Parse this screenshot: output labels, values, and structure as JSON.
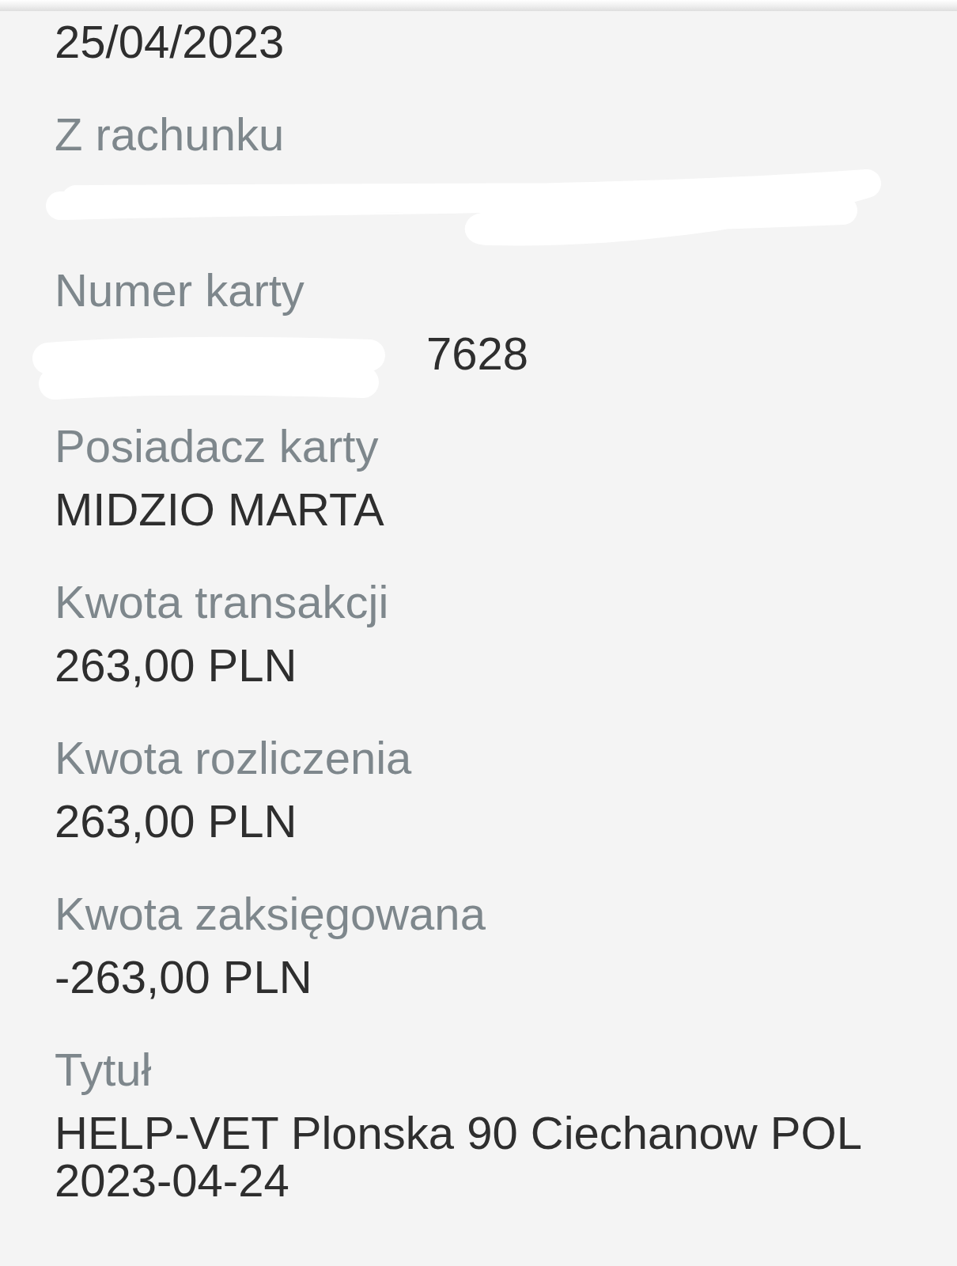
{
  "fields": [
    {
      "value": "25/04/2023",
      "redacted": false
    },
    {
      "label": "Z rachunku",
      "redacted": true
    },
    {
      "label": "Numer karty",
      "redacted": true,
      "value": "7628"
    },
    {
      "label": "Posiadacz karty",
      "value": "MIDZIO MARTA",
      "redacted": false
    },
    {
      "label": "Kwota transakcji",
      "value": "263,00 PLN",
      "redacted": false
    },
    {
      "label": "Kwota rozliczenia",
      "value": "263,00 PLN",
      "redacted": false
    },
    {
      "label": "Kwota zaksięgowana",
      "value": "-263,00 PLN",
      "redacted": false
    },
    {
      "label": "Tytuł",
      "value": "HELP-VET Plonska 90 Ciechanow POL 2023-04-24",
      "redacted": false
    }
  ]
}
